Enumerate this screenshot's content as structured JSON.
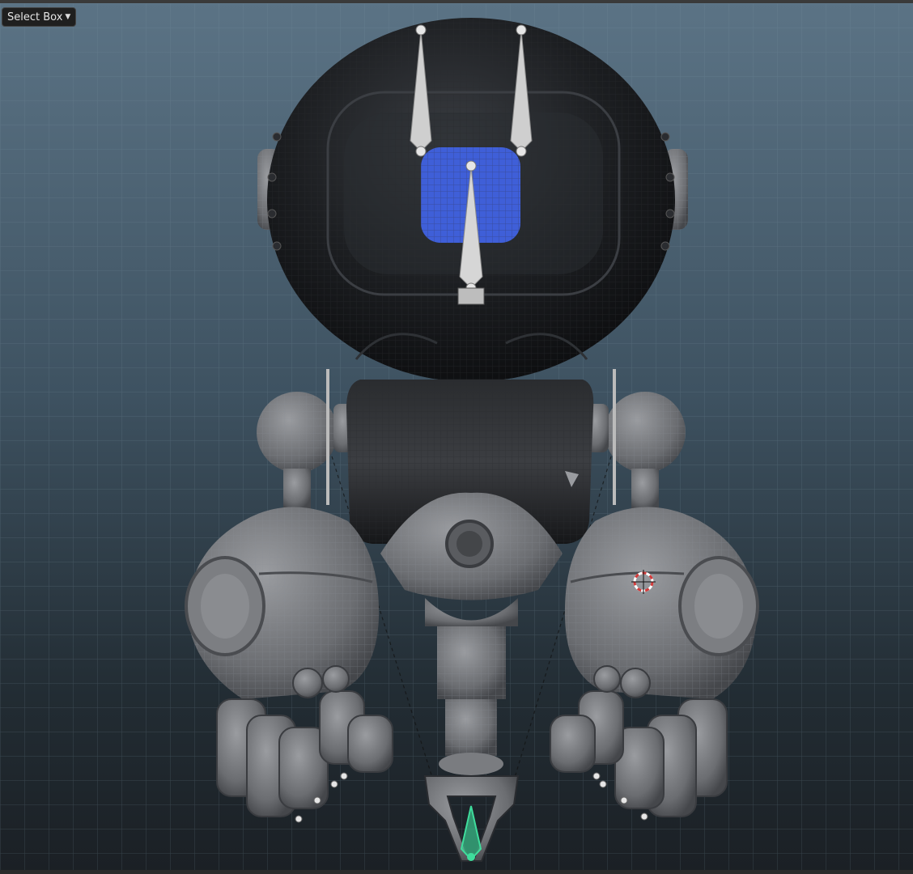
{
  "toolbar": {
    "select_mode_label": "Select Box"
  },
  "icons": {
    "dropdown": "chevron-down-icon",
    "cursor": "3d-cursor-icon"
  },
  "colors": {
    "viewport_top": "#5b7385",
    "viewport_bottom": "#1b2025",
    "grid_line": "#6e8798",
    "head_shell": "#1a1c1f",
    "body_mesh": "#707276",
    "face_screen": "#3f5fd8",
    "bone": "#cfcfcf",
    "selected_bone": "#3fdc9c",
    "cursor_ring": "#d23a3a"
  }
}
